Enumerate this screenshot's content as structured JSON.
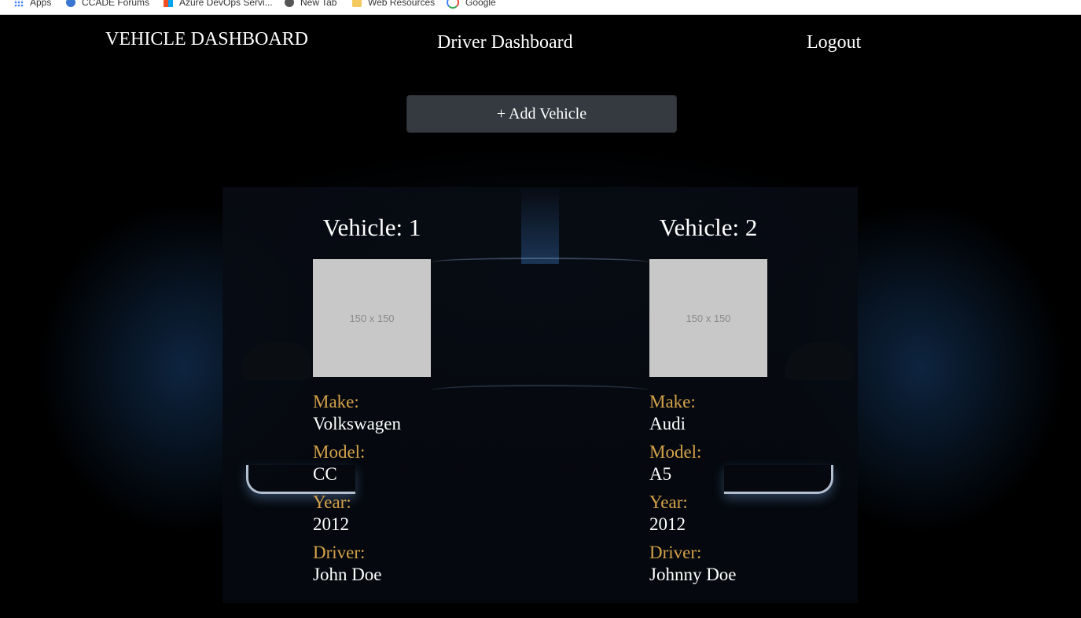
{
  "browser": {
    "bookmarks": [
      {
        "label": "Apps",
        "icon": "apps-grid-icon"
      },
      {
        "label": "CCADE Forums",
        "icon": "globe-icon"
      },
      {
        "label": "Azure DevOps Servi...",
        "icon": "azure-icon"
      },
      {
        "label": "New Tab",
        "icon": "new-tab-icon"
      },
      {
        "label": "Web Resources",
        "icon": "folder-icon"
      },
      {
        "label": "Google",
        "icon": "google-icon"
      }
    ]
  },
  "nav": {
    "brand": "VEHICLE DASHBOARD",
    "driver_link": "Driver Dashboard",
    "logout_link": "Logout"
  },
  "actions": {
    "add_vehicle": "+ Add Vehicle"
  },
  "labels": {
    "make": "Make:",
    "model": "Model:",
    "year": "Year:",
    "driver": "Driver:"
  },
  "vehicles": [
    {
      "title": "Vehicle: 1",
      "image_placeholder": "150 x 150",
      "make": "Volkswagen",
      "model": "CC",
      "year": "2012",
      "driver": "John Doe"
    },
    {
      "title": "Vehicle: 2",
      "image_placeholder": "150 x 150",
      "make": "Audi",
      "model": "A5",
      "year": "2012",
      "driver": "Johnny Doe"
    }
  ],
  "colors": {
    "background": "#000000",
    "button": "#343a40",
    "label_accent": "#d4a24a",
    "text": "#ffffff",
    "placeholder": "#c8c8c8"
  }
}
